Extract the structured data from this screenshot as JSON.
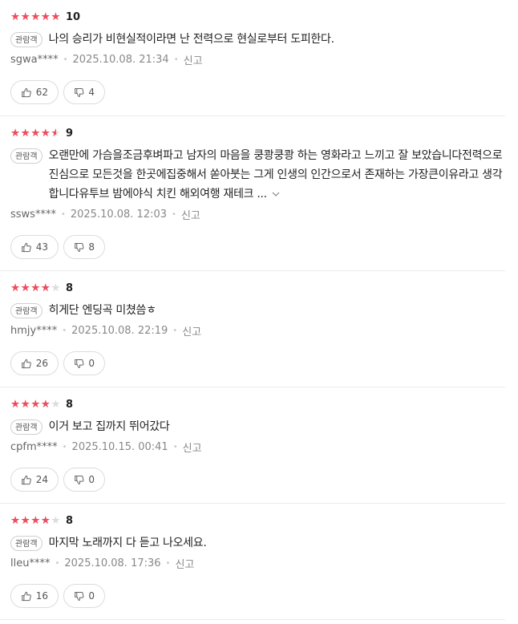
{
  "reviews": [
    {
      "rating": 10,
      "rating_label": "10",
      "badge": "관람객",
      "text": "나의 승리가 비현실적이라면 난 전력으로 현실로부터 도피한다.",
      "author": "sgwa****",
      "date": "2025.10.08. 21:34",
      "report": "신고",
      "likes": "62",
      "dislikes": "4",
      "truncated": false
    },
    {
      "rating": 9,
      "rating_label": "9",
      "badge": "관람객",
      "text": "오랜만에 가슴을조금후벼파고 남자의 마음을 쿵쾅쿵쾅 하는 영화라고 느끼고 잘 보았습니다전력으로 진심으로 모든것을 한곳에집중해서 쏟아붓는 그게 인생의 인간으로서 존재하는 가장큰이유라고 생각합니다유투브 밤에야식 치킨 해외여행 재테크 ...",
      "author": "ssws****",
      "date": "2025.10.08. 12:03",
      "report": "신고",
      "likes": "43",
      "dislikes": "8",
      "truncated": true
    },
    {
      "rating": 8,
      "rating_label": "8",
      "badge": "관람객",
      "text": "히게단 엔딩곡 미쳤씀ㅎ",
      "author": "hmjy****",
      "date": "2025.10.08. 22:19",
      "report": "신고",
      "likes": "26",
      "dislikes": "0",
      "truncated": false
    },
    {
      "rating": 8,
      "rating_label": "8",
      "badge": "관람객",
      "text": "이거 보고 집까지 뛰어갔다",
      "author": "cpfm****",
      "date": "2025.10.15. 00:41",
      "report": "신고",
      "likes": "24",
      "dislikes": "0",
      "truncated": false
    },
    {
      "rating": 8,
      "rating_label": "8",
      "badge": "관람객",
      "text": "마지막 노래까지 다 듣고 나오세요.",
      "author": "lleu****",
      "date": "2025.10.08. 17:36",
      "report": "신고",
      "likes": "16",
      "dislikes": "0",
      "truncated": false
    }
  ],
  "colors": {
    "star": "#f04c5c",
    "star_empty": "#dcdcdc",
    "meta": "#888888"
  },
  "icons": {
    "like": "thumbs-up-icon",
    "dislike": "thumbs-down-icon",
    "more": "chevron-down-icon"
  }
}
